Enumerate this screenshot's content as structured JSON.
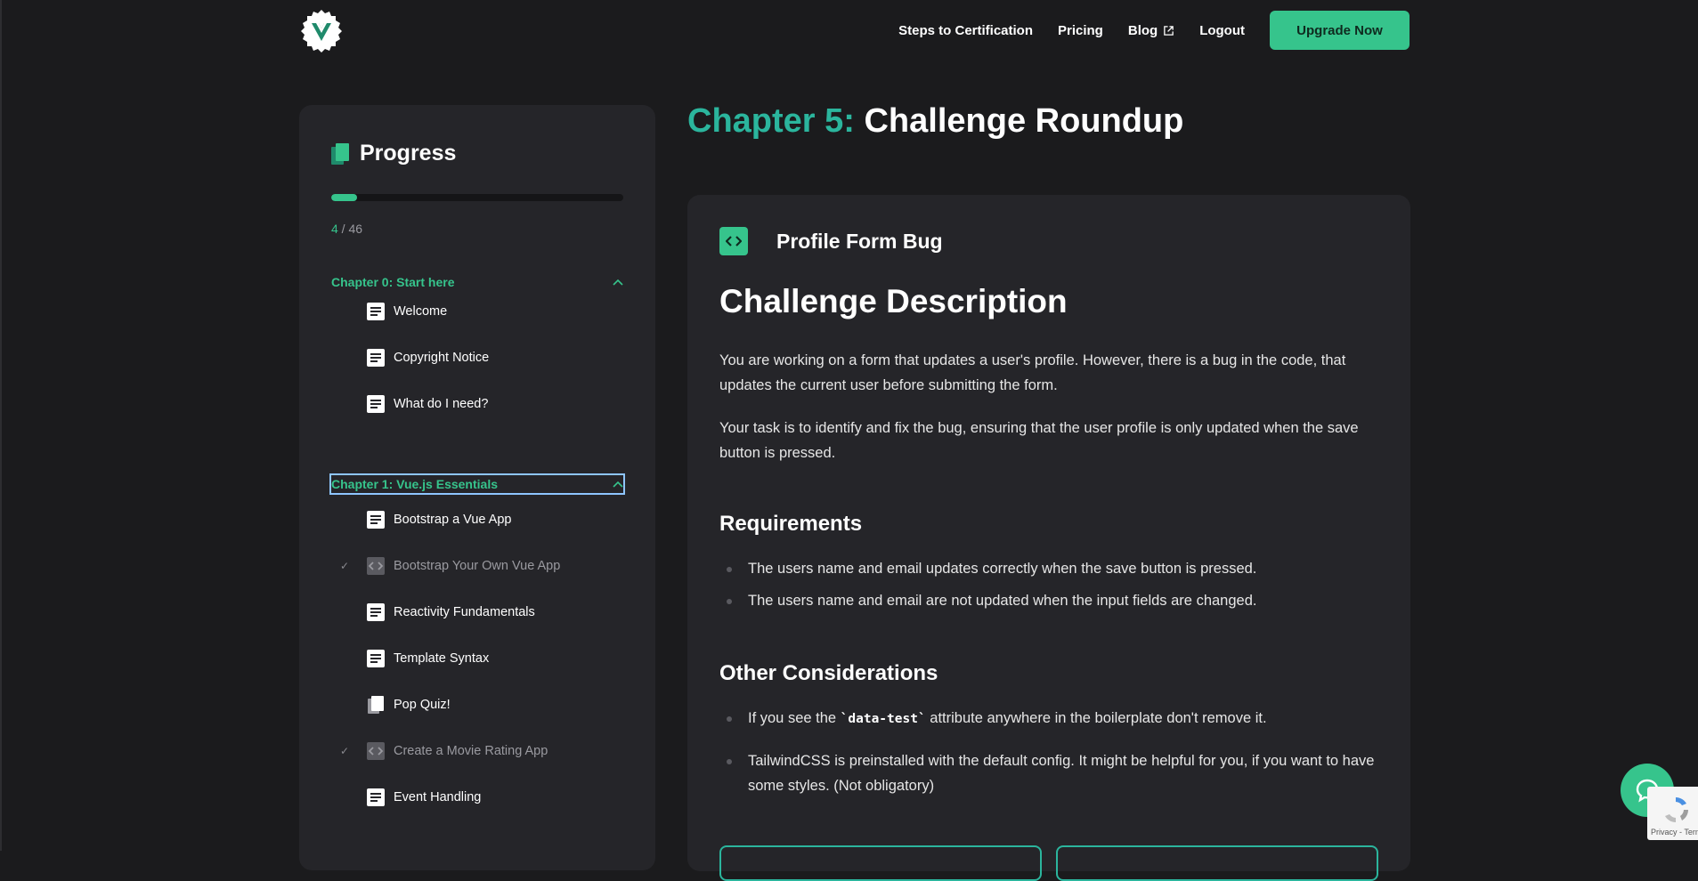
{
  "nav": {
    "items": [
      "Steps to Certification",
      "Pricing",
      "Blog",
      "Logout"
    ],
    "upgrade": "Upgrade Now"
  },
  "sidebar": {
    "title": "Progress",
    "progress": {
      "current": "4",
      "separator": " / ",
      "total": "46",
      "fraction": 0.087
    },
    "chapters": [
      {
        "label": "Chapter 0: Start here",
        "lessons": [
          {
            "label": "Welcome",
            "icon": "document-icon",
            "done": false
          },
          {
            "label": "Copyright Notice",
            "icon": "document-icon",
            "done": false
          },
          {
            "label": "What do I need?",
            "icon": "document-icon",
            "done": false
          }
        ]
      },
      {
        "label": "Chapter 1: Vue.js Essentials",
        "lessons": [
          {
            "label": "Bootstrap a Vue App",
            "icon": "document-icon",
            "done": false
          },
          {
            "label": "Bootstrap Your Own Vue App",
            "icon": "code-icon",
            "done": true
          },
          {
            "label": "Reactivity Fundamentals",
            "icon": "document-icon",
            "done": false
          },
          {
            "label": "Template Syntax",
            "icon": "document-icon",
            "done": false
          },
          {
            "label": "Pop Quiz!",
            "icon": "quiz-icon",
            "done": false
          },
          {
            "label": "Create a Movie Rating App",
            "icon": "code-icon",
            "done": true
          },
          {
            "label": "Event Handling",
            "icon": "document-icon",
            "done": false
          }
        ]
      }
    ]
  },
  "main": {
    "chapter_number": "Chapter 5:",
    "chapter_title": "Challenge Roundup",
    "challenge_title": "Profile Form Bug",
    "description_heading": "Challenge Description",
    "paragraphs": [
      "You are working on a form that updates a user's profile. However, there is a bug in the code, that updates the current user before submitting the form.",
      "Your task is to identify and fix the bug, ensuring that the user profile is only updated when the save button is pressed."
    ],
    "requirements_heading": "Requirements",
    "requirements": [
      "The users name and email updates correctly when the save button is pressed.",
      "The users name and email are not updated when the input fields are changed."
    ],
    "considerations_heading": "Other Considerations",
    "consideration_1": {
      "before": "If you see the ",
      "code": "`data-test`",
      "after": " attribute anywhere in the boilerplate don't remove it."
    },
    "consideration_2": "TailwindCSS is preinstalled with the default config. It might be helpful for you, if you want to have some styles. (Not obligatory)"
  },
  "recaptcha": {
    "text": "Privacy - Terms"
  },
  "colors": {
    "accent": "#36c48c",
    "teal": "#2bb59d",
    "background": "#1b1b1d",
    "panel": "#252529"
  }
}
